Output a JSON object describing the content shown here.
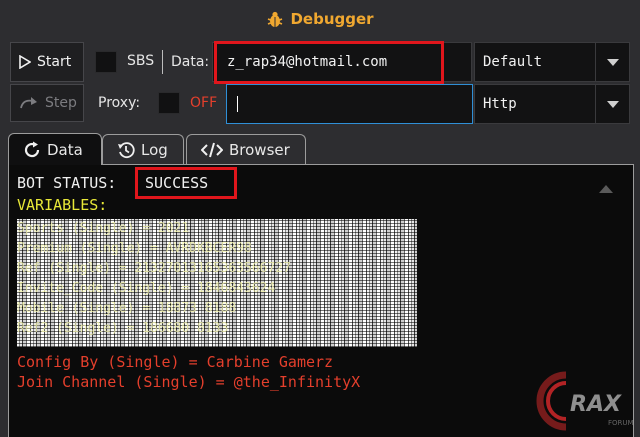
{
  "window": {
    "title": "Debugger",
    "title_icon": "bug-icon"
  },
  "toolbar": {
    "start_label": "Start",
    "step_label": "Step",
    "sbs_label": "SBS",
    "data_label": "Data:",
    "data_value": "z_rap34@hotmail.com",
    "proxy_label": "Proxy:",
    "proxy_state": "OFF",
    "proxy_value": "",
    "data_type_selected": "Default",
    "proxy_type_selected": "Http"
  },
  "tabs": [
    {
      "label": "Data",
      "icon": "refresh-icon",
      "active": true
    },
    {
      "label": "Log",
      "icon": "history-icon",
      "active": false
    },
    {
      "label": "Browser",
      "icon": "code-icon",
      "active": false
    }
  ],
  "console": {
    "status_prefix": "BOT STATUS: ",
    "status_value": "SUCCESS",
    "variables_header": "VARIABLES:",
    "redacted_lines": [
      "Sports (Single) = 2021",
      "Premium (Single) = AVRDKBCER98",
      "Ref (Single) = 21327013165363566727",
      "Invite_Code (Single) = 1846843624",
      "Mobile (Single) = 18873 8188",
      "Ref2 (Single) = 186680 8133"
    ],
    "config_line": "Config By (Single) = Carbine Gamerz",
    "join_line": "Join Channel (Single) = @the_InfinityX"
  },
  "watermark": {
    "text": "RAX",
    "subtext": "FORUM"
  },
  "colors": {
    "accent_title": "#f0a830",
    "status_yellow": "#e8e838",
    "capture_red": "#e43f2c",
    "highlight_box": "#e0161c",
    "focus_blue": "#2f8fd6"
  }
}
